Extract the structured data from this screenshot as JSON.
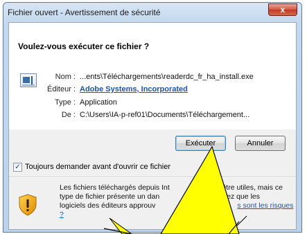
{
  "window": {
    "title": "Fichier ouvert - Avertissement de sécurité",
    "close_label": "x"
  },
  "dialog": {
    "question": "Voulez-vous exécuter ce fichier ?",
    "fields": {
      "name_label": "Nom :",
      "name_value": "...ents\\Téléchargements\\readerdc_fr_ha_install.exe",
      "publisher_label": "Éditeur :",
      "publisher_value": "Adobe Systems, Incorporated",
      "type_label": "Type :",
      "type_value": "Application",
      "from_label": "De :",
      "from_value": "C:\\Users\\IA-p-ref01\\Documents\\Téléchargement..."
    },
    "buttons": {
      "run_label": "Exécuter",
      "cancel_label": "Annuler"
    },
    "checkbox": {
      "label": "Toujours demander avant d'ouvrir ce fichier",
      "checked": true
    },
    "warning": {
      "text_line1_a": "Les fichiers téléchargés depuis Int",
      "text_line1_b": "nt être utiles, mais ce",
      "text_line2_a": "type de fichier présente un dan",
      "text_line2_b": "exécutez que les",
      "text_line3_a": "logiciels des éditeurs approuv",
      "link_text": "s sont les risques ?"
    }
  },
  "annotation": {
    "shape": "yellow-callout-star",
    "color": "#ffff00"
  }
}
